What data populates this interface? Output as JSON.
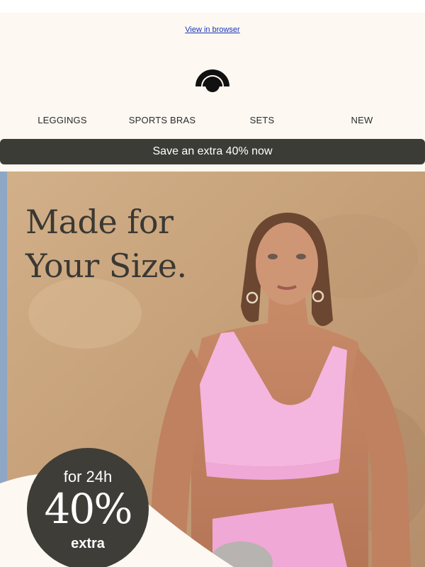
{
  "header": {
    "view_in_browser": "View in browser",
    "logo_icon": "brand-logo-icon"
  },
  "nav": {
    "items": [
      {
        "label": "LEGGINGS"
      },
      {
        "label": "SPORTS BRAS"
      },
      {
        "label": "SETS"
      },
      {
        "label": "NEW"
      }
    ]
  },
  "promo_bar": {
    "label": "Save an extra 40% now"
  },
  "hero": {
    "headline_line1": "Made for",
    "headline_line2": "Your Size.",
    "badge": {
      "top": "for 24h",
      "big": "40%",
      "bottom": "extra"
    }
  },
  "colors": {
    "background": "#fdf8f2",
    "promo_bar": "#3c3c36",
    "link": "#1a36b8",
    "badge": "#3e3d38",
    "bra_pink": "#f4b6df"
  }
}
